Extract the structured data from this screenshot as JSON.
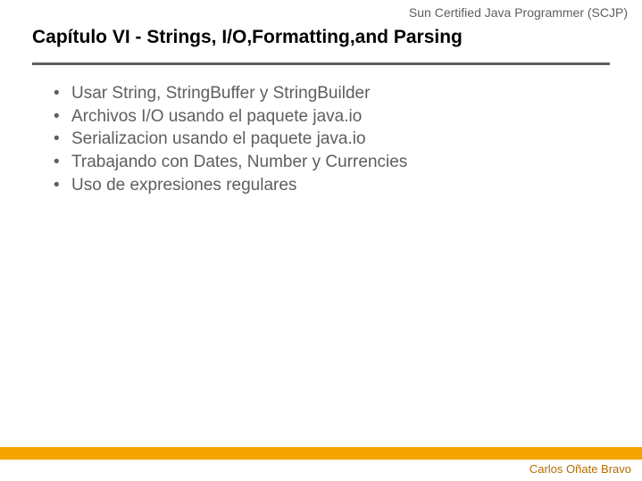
{
  "header": {
    "label": "Sun Certified Java Programmer (SCJP)"
  },
  "title": "Capítulo VI - Strings, I/O,Formatting,and Parsing",
  "bullets": {
    "item0": "Usar String, StringBuffer y StringBuilder",
    "item1": "Archivos I/O usando el paquete java.io",
    "item2": "Serializacion usando el paquete java.io",
    "item3": "Trabajando con Dates, Number y Currencies",
    "item4": "Uso de expresiones regulares"
  },
  "footer": {
    "author": "Carlos Oñate Bravo"
  }
}
